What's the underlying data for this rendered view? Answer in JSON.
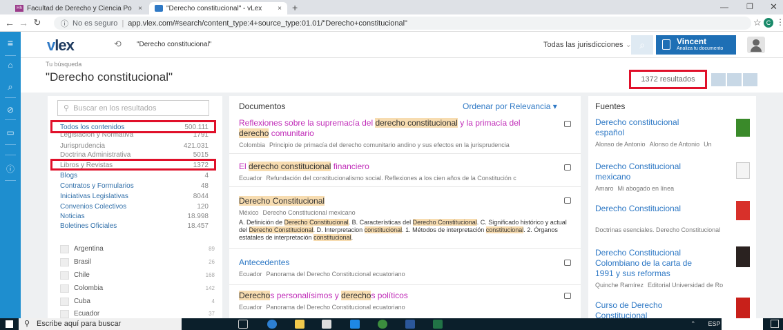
{
  "tabs": [
    {
      "label": "Facultad de Derecho y Ciencia Po",
      "close": "×"
    },
    {
      "label": "\"Derecho constitucional\" - vLex",
      "close": "×"
    }
  ],
  "new_tab": "+",
  "address": {
    "security": "No es seguro",
    "url": "app.vlex.com/#search/content_type:4+source_type:01.01/\"Derecho+constitucional\""
  },
  "header": {
    "logo_v": "v",
    "logo_lex": "lex",
    "search_query": "\"Derecho constitucional\"",
    "jurisdiction": "Todas las jurisdicciones",
    "user_name": "Vincent",
    "user_subtitle": "Analiza tu documento"
  },
  "summary": {
    "label": "Tu búsqueda",
    "query": "\"Derecho constitucional\"",
    "results": "1372 resultados"
  },
  "filters": {
    "search_placeholder": "Buscar en los resultados",
    "content_types": [
      {
        "label": "Todos los contenidos",
        "count": "500.111"
      },
      {
        "label": "Legislación y Normativa",
        "count": "1791"
      },
      {
        "label": "Jurisprudencia",
        "count": "421.031"
      },
      {
        "label": "Doctrina Administrativa",
        "count": "5015"
      },
      {
        "label": "Libros y Revistas",
        "count": "1372"
      },
      {
        "label": "Blogs",
        "count": "4"
      },
      {
        "label": "Contratos y Formularios",
        "count": "48"
      },
      {
        "label": "Iniciativas Legislativas",
        "count": "8044"
      },
      {
        "label": "Convenios Colectivos",
        "count": "120"
      },
      {
        "label": "Noticias",
        "count": "18.998"
      },
      {
        "label": "Boletines Oficiales",
        "count": "18.457"
      }
    ],
    "countries": [
      {
        "label": "Argentina",
        "count": "89"
      },
      {
        "label": "Brasil",
        "count": "26"
      },
      {
        "label": "Chile",
        "count": "168"
      },
      {
        "label": "Colombia",
        "count": "142"
      },
      {
        "label": "Cuba",
        "count": "4"
      },
      {
        "label": "Ecuador",
        "count": "37"
      }
    ]
  },
  "documents": {
    "header": "Documentos",
    "sort": "Ordenar por Relevancia ▾",
    "items": [
      {
        "t1": "Reflexiones sobre la supremacía del ",
        "t2": "derecho constitucional",
        "t3": " y la primacía del ",
        "t4": "derecho",
        "t5": " comunitario",
        "country": "Colombia",
        "meta": "Principio de primacía del derecho comunitario andino y sus efectos en la jurisprudencia"
      },
      {
        "t1": "El ",
        "t2": "derecho constitucional",
        "t3": " financiero",
        "country": "Ecuador",
        "meta": "Refundación del constitucionalismo social. Reflexiones a los cien años de la Constitución c"
      },
      {
        "t1": "Derecho Constitucional",
        "country": "México",
        "meta": "Derecho Constitucional mexicano",
        "b1": "A. Definición de ",
        "b2": "Derecho Constitucional",
        "b3": ". B. Características del ",
        "b4": "Derecho Constitucional",
        "b5": ". C. Significado histórico y actual del ",
        "b6": "Derecho Constitucional",
        "b7": ". D. Interpretacion ",
        "b8": "constitucional",
        "b9": ". 1. Métodos de interpretación ",
        "b10": "constitucional",
        "b11": ". 2. Órganos estatales de interpretación ",
        "b12": "constitucional",
        "b13": "."
      },
      {
        "t1": "Antecedentes",
        "country": "Ecuador",
        "meta": "Panorama del Derecho Constitucional ecuatoriano"
      },
      {
        "t1": "Derecho",
        "t2": "s personalísimos y ",
        "t3": "derecho",
        "t4": "s políticos",
        "country": "Ecuador",
        "meta": "Panorama del Derecho Constitucional ecuatoriano"
      }
    ]
  },
  "sources": {
    "header": "Fuentes",
    "items": [
      {
        "title": "Derecho constitucional español",
        "a": "Alonso de Antonio",
        "b": "Alonso de Antonio",
        "c": "Un"
      },
      {
        "title": "Derecho Constitucional mexicano",
        "a": "Amaro",
        "b": "Mi abogado en línea",
        "c": ""
      },
      {
        "title": "Derecho Constitucional",
        "a": "Doctrinas esenciales. Derecho Constitucional",
        "b": "",
        "c": ""
      },
      {
        "title": "Derecho Constitucional Colombiano de la carta de 1991 y sus reformas",
        "a": "Quinche Ramírez",
        "b": "Editorial Universidad de Ro",
        "c": ""
      },
      {
        "title": "Curso de Derecho Constitucional",
        "a": "",
        "b": "",
        "c": ""
      }
    ]
  },
  "taskbar": {
    "search": "Escribe aquí para buscar",
    "lang": "ESP"
  }
}
